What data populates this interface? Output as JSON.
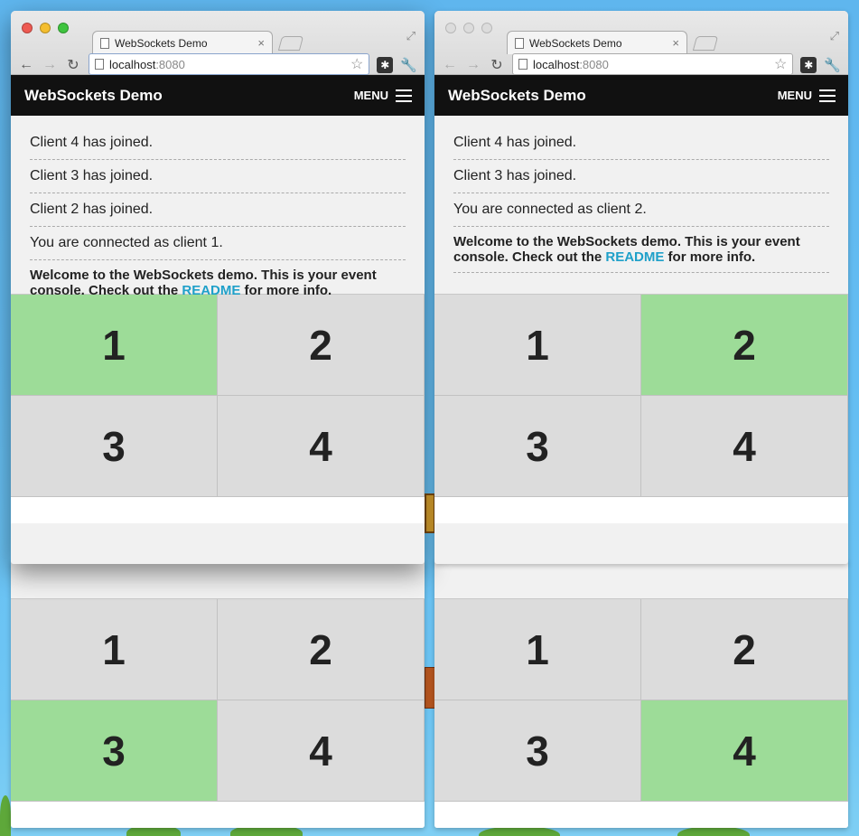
{
  "desktop": {},
  "windows": [
    {
      "tab": {
        "title": "WebSockets Demo",
        "close": "×"
      },
      "omnibox": {
        "host": "localhost",
        "port": ":8080"
      },
      "app": {
        "title": "WebSockets Demo",
        "menu": "MENU"
      },
      "console": [
        "Client 4 has joined.",
        "Client 3 has joined.",
        "Client 2 has joined.",
        "You are connected as client 1."
      ],
      "welcome": {
        "pre": "Welcome to the WebSockets demo. This is your event console. Check out the ",
        "link": "README",
        "post": " for more info."
      },
      "cells": [
        "1",
        "2",
        "3",
        "4"
      ],
      "active_cell": "1"
    },
    {
      "tab": {
        "title": "WebSockets Demo",
        "close": "×"
      },
      "omnibox": {
        "host": "localhost",
        "port": ":8080"
      },
      "app": {
        "title": "WebSockets Demo",
        "menu": "MENU"
      },
      "console": [
        "Client 4 has joined.",
        "Client 3 has joined.",
        "You are connected as client 2."
      ],
      "welcome": {
        "pre": "Welcome to the WebSockets demo. This is your event console. Check out the ",
        "link": "README",
        "post": " for more info."
      },
      "cells": [
        "1",
        "2",
        "3",
        "4"
      ],
      "active_cell": "2"
    },
    {
      "cells": [
        "1",
        "2",
        "3",
        "4"
      ],
      "active_cell": "3"
    },
    {
      "cells": [
        "1",
        "2",
        "3",
        "4"
      ],
      "active_cell": "4"
    }
  ],
  "colors": {
    "active_cell": "#9ddc98",
    "inactive_cell": "#dcdcdc",
    "appbar": "#111111",
    "link": "#1fa0c9"
  },
  "icons": {
    "back": "back-arrow-icon",
    "forward": "forward-arrow-icon",
    "reload": "reload-icon",
    "star": "star-icon",
    "extension": "extension-icon",
    "wrench": "wrench-icon",
    "menu": "hamburger-icon"
  }
}
